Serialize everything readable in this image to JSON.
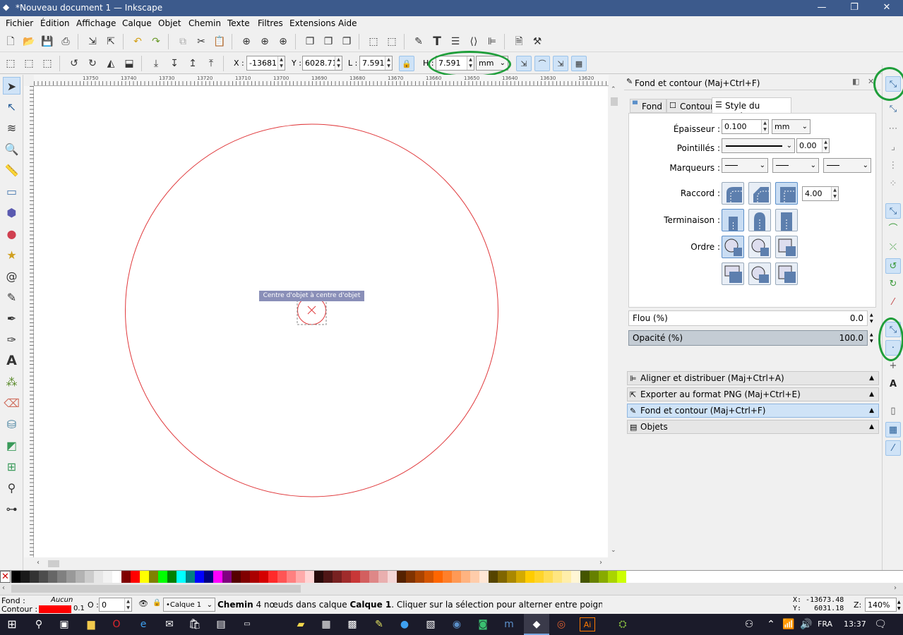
{
  "titlebar": {
    "title": "*Nouveau document 1 — Inkscape",
    "minimize": "—",
    "maximize": "❐",
    "close": "✕"
  },
  "menu": [
    "Fichier",
    "Édition",
    "Affichage",
    "Calque",
    "Objet",
    "Chemin",
    "Texte",
    "Filtres",
    "Extensions",
    "Aide"
  ],
  "toolbar2": {
    "x_label": "X :",
    "x_value": "-13681.",
    "y_label": "Y :",
    "y_value": "6028.71",
    "w_label": "L :",
    "w_value": "7.591",
    "h_label": "H :",
    "h_value": "7.591",
    "unit": "mm"
  },
  "ruler": {
    "h_ticks": [
      "13750",
      "13740",
      "13730",
      "13720",
      "13710",
      "13700",
      "13690",
      "13680",
      "13670",
      "13660",
      "13650",
      "13640",
      "13630",
      "13620"
    ]
  },
  "canvas": {
    "snap_tooltip": "Centre d'objet à centre d'objet"
  },
  "panel": {
    "title": "Fond et contour (Maj+Ctrl+F)",
    "tabs": [
      "Fond",
      "Contour",
      "Style du contour"
    ],
    "epaisseur_label": "Épaisseur :",
    "epaisseur_value": "0.100",
    "epaisseur_unit": "mm",
    "pointilles_label": "Pointillés :",
    "pointilles_value": "0.00",
    "marqueurs_label": "Marqueurs :",
    "raccord_label": "Raccord :",
    "raccord_value": "4.00",
    "terminaison_label": "Terminaison :",
    "ordre_label": "Ordre :",
    "flou_label": "Flou (%)",
    "flou_value": "0.0",
    "opacite_label": "Opacité (%)",
    "opacite_value": "100.0",
    "docks": [
      "Aligner et distribuer (Maj+Ctrl+A)",
      "Exporter au format PNG (Maj+Ctrl+E)",
      "Fond et contour (Maj+Ctrl+F)",
      "Objets"
    ]
  },
  "palette_colors": [
    "#000000",
    "#1a1a1a",
    "#333333",
    "#4d4d4d",
    "#666666",
    "#808080",
    "#999999",
    "#b3b3b3",
    "#cccccc",
    "#e6e6e6",
    "#f2f2f2",
    "#ffffff",
    "#800000",
    "#ff0000",
    "#ffff00",
    "#808000",
    "#00ff00",
    "#008000",
    "#00ffff",
    "#008080",
    "#0000ff",
    "#000080",
    "#ff00ff",
    "#800080",
    "#550000",
    "#800000",
    "#aa0000",
    "#d40000",
    "#ff2a2a",
    "#ff5555",
    "#ff8080",
    "#ffaaaa",
    "#ffd5d5",
    "#280b0b",
    "#501616",
    "#782121",
    "#a02c2c",
    "#c83737",
    "#d35f5f",
    "#de8787",
    "#e9afaf",
    "#f4d7d7",
    "#552200",
    "#803300",
    "#aa4400",
    "#d45500",
    "#ff6600",
    "#ff7f2a",
    "#ff9955",
    "#ffb380",
    "#ffccaa",
    "#ffe6d5",
    "#554400",
    "#806600",
    "#aa8800",
    "#d4aa00",
    "#ffcc00",
    "#ffd42a",
    "#ffdd55",
    "#ffe680",
    "#ffeeaa",
    "#fff6d5",
    "#445500",
    "#668000",
    "#88aa00",
    "#aad400",
    "#ccff00"
  ],
  "status": {
    "fond_label": "Fond :",
    "fond_value": "Aucun",
    "contour_label": "Contour :",
    "contour_width": "0.1",
    "contour_color": "#ff0000",
    "opacity_label": "O :",
    "opacity_value": "0",
    "layer": "•Calque 1",
    "message_bold1": "Chemin",
    "message1": " 4 nœuds dans calque ",
    "message_bold2": "Calque 1",
    "message2": ". Cliquer sur la sélection pour alterner entre poignées de redimer",
    "cursor_x": "X: -13673.48",
    "cursor_y": "Y:   6031.18",
    "zoom_label": "Z:",
    "zoom_value": "140%"
  },
  "taskbar": {
    "lang": "FRA",
    "time": "13:37"
  },
  "colors": {
    "accent": "#3c5a8c",
    "circle_stroke": "#e0393c",
    "highlight": "#1f9e3a"
  }
}
